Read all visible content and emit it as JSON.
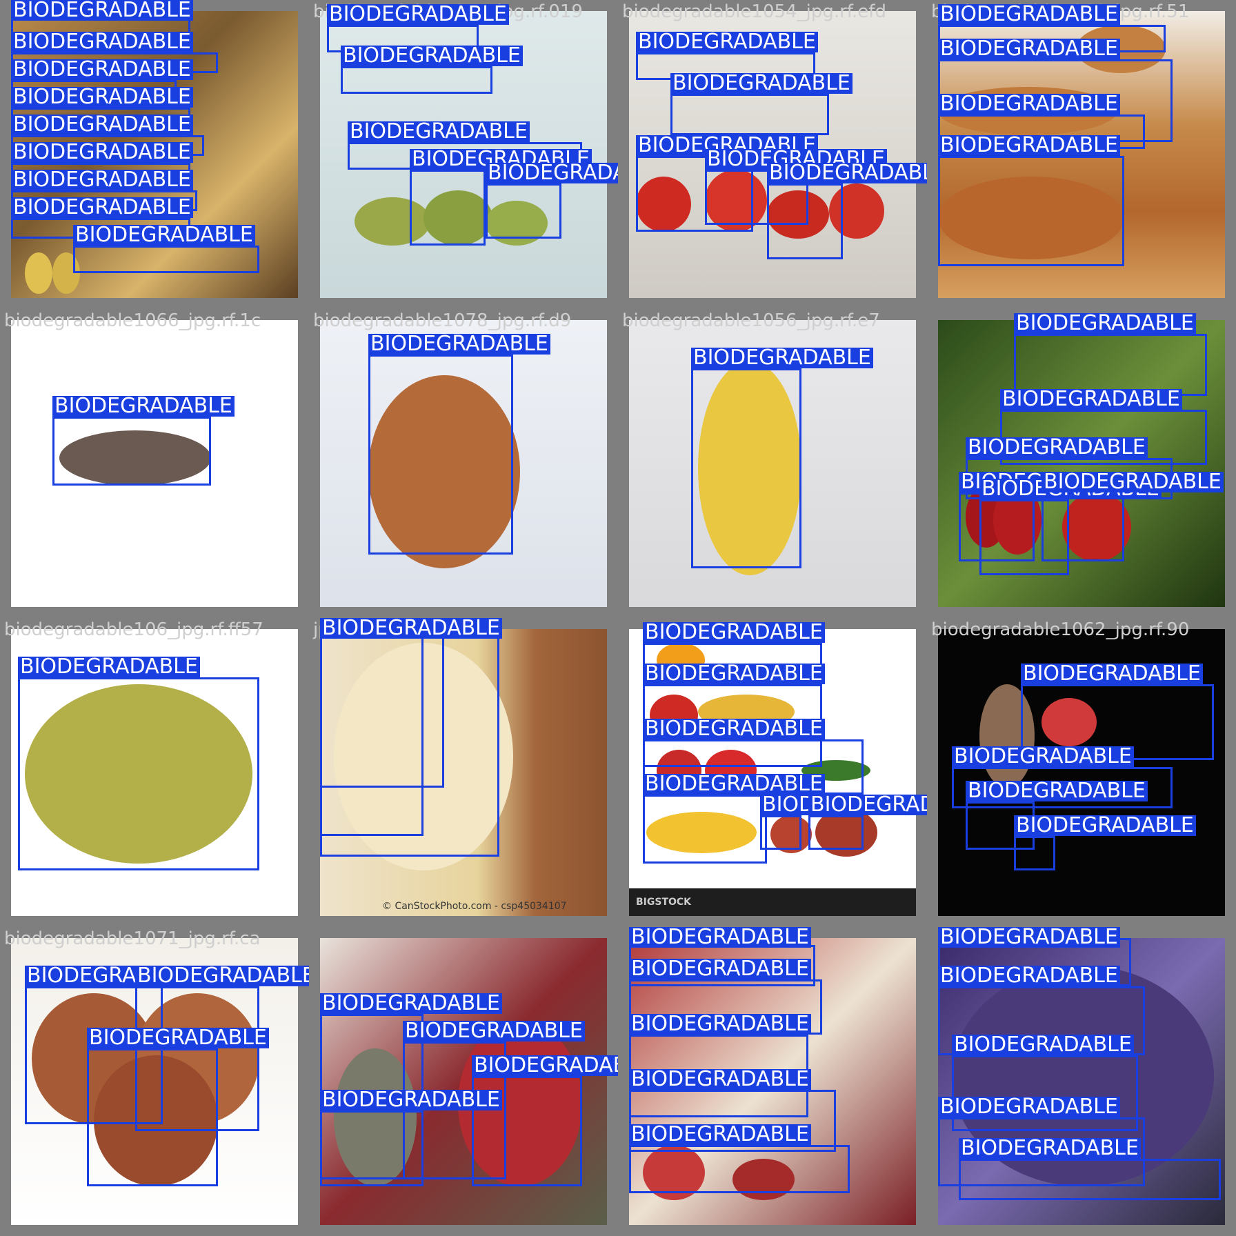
{
  "grid": {
    "label_text": "BIODEGRADABLE",
    "box_color": "#1a3fe0",
    "tiles": [
      {
        "filename": "",
        "theme": "potato-pile"
      },
      {
        "filename": "biodegradable1071_jpg.rf.019",
        "theme": "guavas"
      },
      {
        "filename": "biodegradable1054_jpg.rf.efd",
        "theme": "tomatoes"
      },
      {
        "filename": "biodegradable1060_jpg.rf.51",
        "theme": "bread"
      },
      {
        "filename": "biodegradable1066_jpg.rf.1c",
        "theme": "peel"
      },
      {
        "filename": "biodegradable1078_jpg.rf.d9",
        "theme": "pear"
      },
      {
        "filename": "biodegradable1056_jpg.rf.e7",
        "theme": "apple"
      },
      {
        "filename": "",
        "theme": "cherries"
      },
      {
        "filename": "biodegradable106_jpg.rf.ff57",
        "theme": "jackfruit"
      },
      {
        "filename": "jpg.rf.db",
        "theme": "tortilla"
      },
      {
        "filename": "",
        "theme": "assorted"
      },
      {
        "filename": "biodegradable1062_jpg.rf.90",
        "theme": "dark"
      },
      {
        "filename": "biodegradable1071_jpg.rf.ca",
        "theme": "medlar"
      },
      {
        "filename": "",
        "theme": "strawberries"
      },
      {
        "filename": "",
        "theme": "crowded1"
      },
      {
        "filename": "",
        "theme": "crowded2"
      }
    ]
  },
  "watermarks": {
    "canstock": "© CanStockPhoto.com - csp45034107",
    "bigstock": "BIGSTOCK"
  }
}
